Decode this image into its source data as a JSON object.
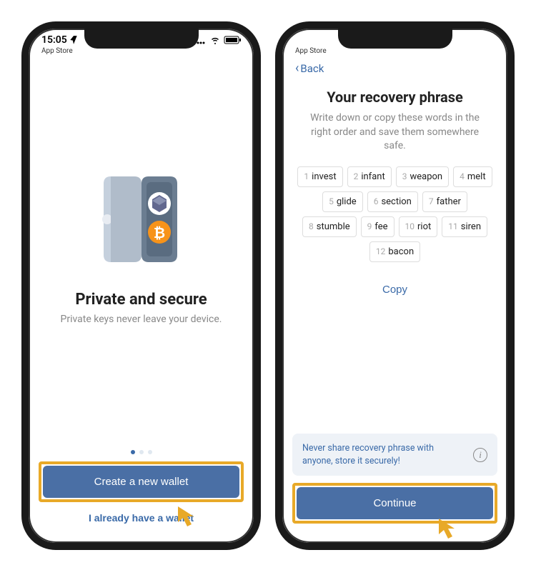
{
  "status": {
    "time": "15:05",
    "appStore": "App Store"
  },
  "screen1": {
    "title": "Private and secure",
    "subtitle": "Private keys never leave your device.",
    "createButton": "Create a new wallet",
    "haveButton": "I already have a wallet"
  },
  "screen2": {
    "back": "Back",
    "title": "Your recovery phrase",
    "subtitle": "Write down or copy these words in the right order and save them somewhere safe.",
    "words": [
      "invest",
      "infant",
      "weapon",
      "melt",
      "glide",
      "section",
      "father",
      "stumble",
      "fee",
      "riot",
      "siren",
      "bacon"
    ],
    "copy": "Copy",
    "warning": "Never share recovery phrase with anyone, store it securely!",
    "continue": "Continue"
  },
  "colors": {
    "accent": "#4a6fa5",
    "highlight": "#e8a928"
  }
}
